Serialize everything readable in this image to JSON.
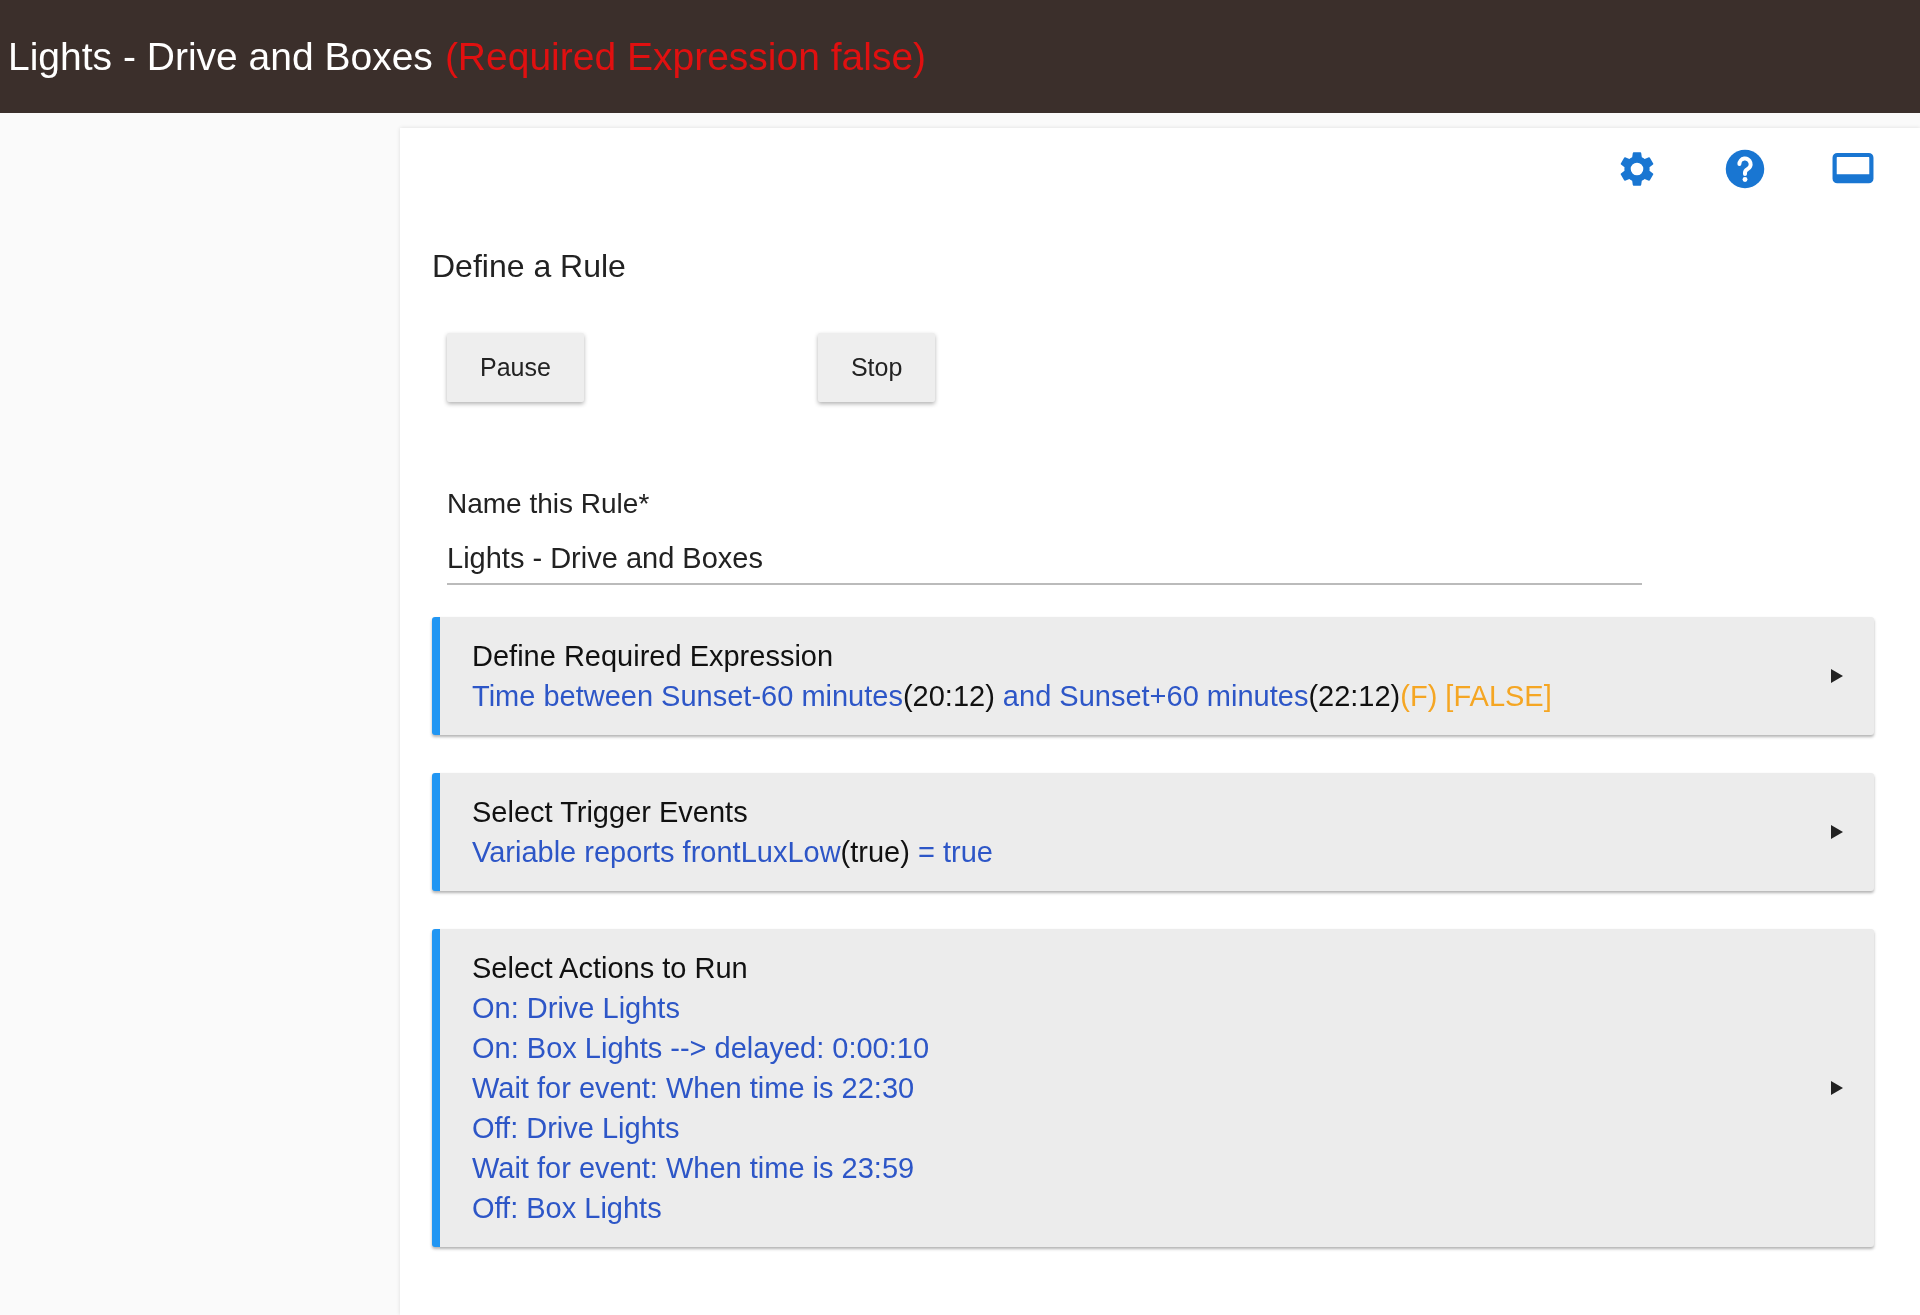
{
  "header": {
    "title": "Lights - Drive and Boxes",
    "status": "(Required Expression false)"
  },
  "heading": "Define a Rule",
  "buttons": [
    "Pause",
    "Stop"
  ],
  "name_field": {
    "label": "Name this Rule*",
    "value": "Lights - Drive and Boxes"
  },
  "sections": [
    {
      "title": "Define Required Expression",
      "lines": [
        [
          {
            "text": "Time between Sunset-60 minutes",
            "kind": "link"
          },
          {
            "text": "(20:12)",
            "kind": "value"
          },
          {
            "text": " and Sunset+60 minutes",
            "kind": "link"
          },
          {
            "text": "(22:12)",
            "kind": "value"
          },
          {
            "text": "(F) [FALSE]",
            "kind": "status"
          }
        ]
      ]
    },
    {
      "title": "Select Trigger Events",
      "lines": [
        [
          {
            "text": "Variable reports frontLuxLow",
            "kind": "link"
          },
          {
            "text": "(true)",
            "kind": "value"
          },
          {
            "text": " = true",
            "kind": "link"
          }
        ]
      ]
    },
    {
      "title": "Select Actions to Run",
      "lines": [
        [
          {
            "text": "On: Drive Lights",
            "kind": "link"
          }
        ],
        [
          {
            "text": "On: Box Lights --> delayed: 0:00:10",
            "kind": "link"
          }
        ],
        [
          {
            "text": "Wait for event: When time is 22:30",
            "kind": "link"
          }
        ],
        [
          {
            "text": "Off: Drive Lights",
            "kind": "link"
          }
        ],
        [
          {
            "text": "Wait for event: When time is 23:59",
            "kind": "link"
          }
        ],
        [
          {
            "text": "Off: Box Lights",
            "kind": "link"
          }
        ]
      ]
    }
  ]
}
